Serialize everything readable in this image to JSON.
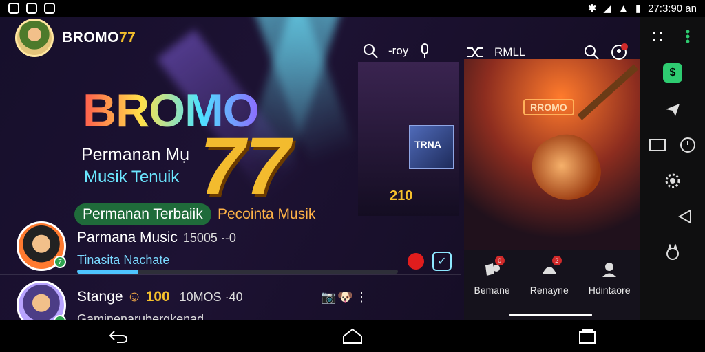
{
  "statusbar": {
    "time": "27:3:90 an"
  },
  "app": {
    "brand_prefix": "BROMO",
    "brand_suffix": "77",
    "toolbar": {
      "left_label": "-roy",
      "right_label": "RMLL"
    },
    "hero": {
      "title": "BROMO",
      "big_number": "77",
      "sub1": "Permanan Mụ",
      "sub2": "Musik Tenuik",
      "pill": "Permanan Terbaiik",
      "alt_text": "Pecointa Musik"
    },
    "card_a": {
      "number": "210",
      "screen_text": "TRNA"
    },
    "card_b": {
      "label": "RROMO"
    },
    "list": [
      {
        "name": "Parmana Music",
        "meta": "15005 ·-0",
        "subtitle": "Tinasita Nachate",
        "progress": 0.19
      },
      {
        "name": "Stange",
        "meta": "10MOS ·40",
        "subtitle": "Gaminenarubergkenad",
        "count": "100"
      }
    ],
    "dock": [
      {
        "label": "Bemane",
        "badge": "0"
      },
      {
        "label": "Renayne",
        "badge": "2"
      },
      {
        "label": "Hdintaore",
        "badge": ""
      }
    ],
    "colors": {
      "accent": "#f5c02c",
      "cyan": "#6be7ff",
      "record": "#e11d1d"
    }
  }
}
